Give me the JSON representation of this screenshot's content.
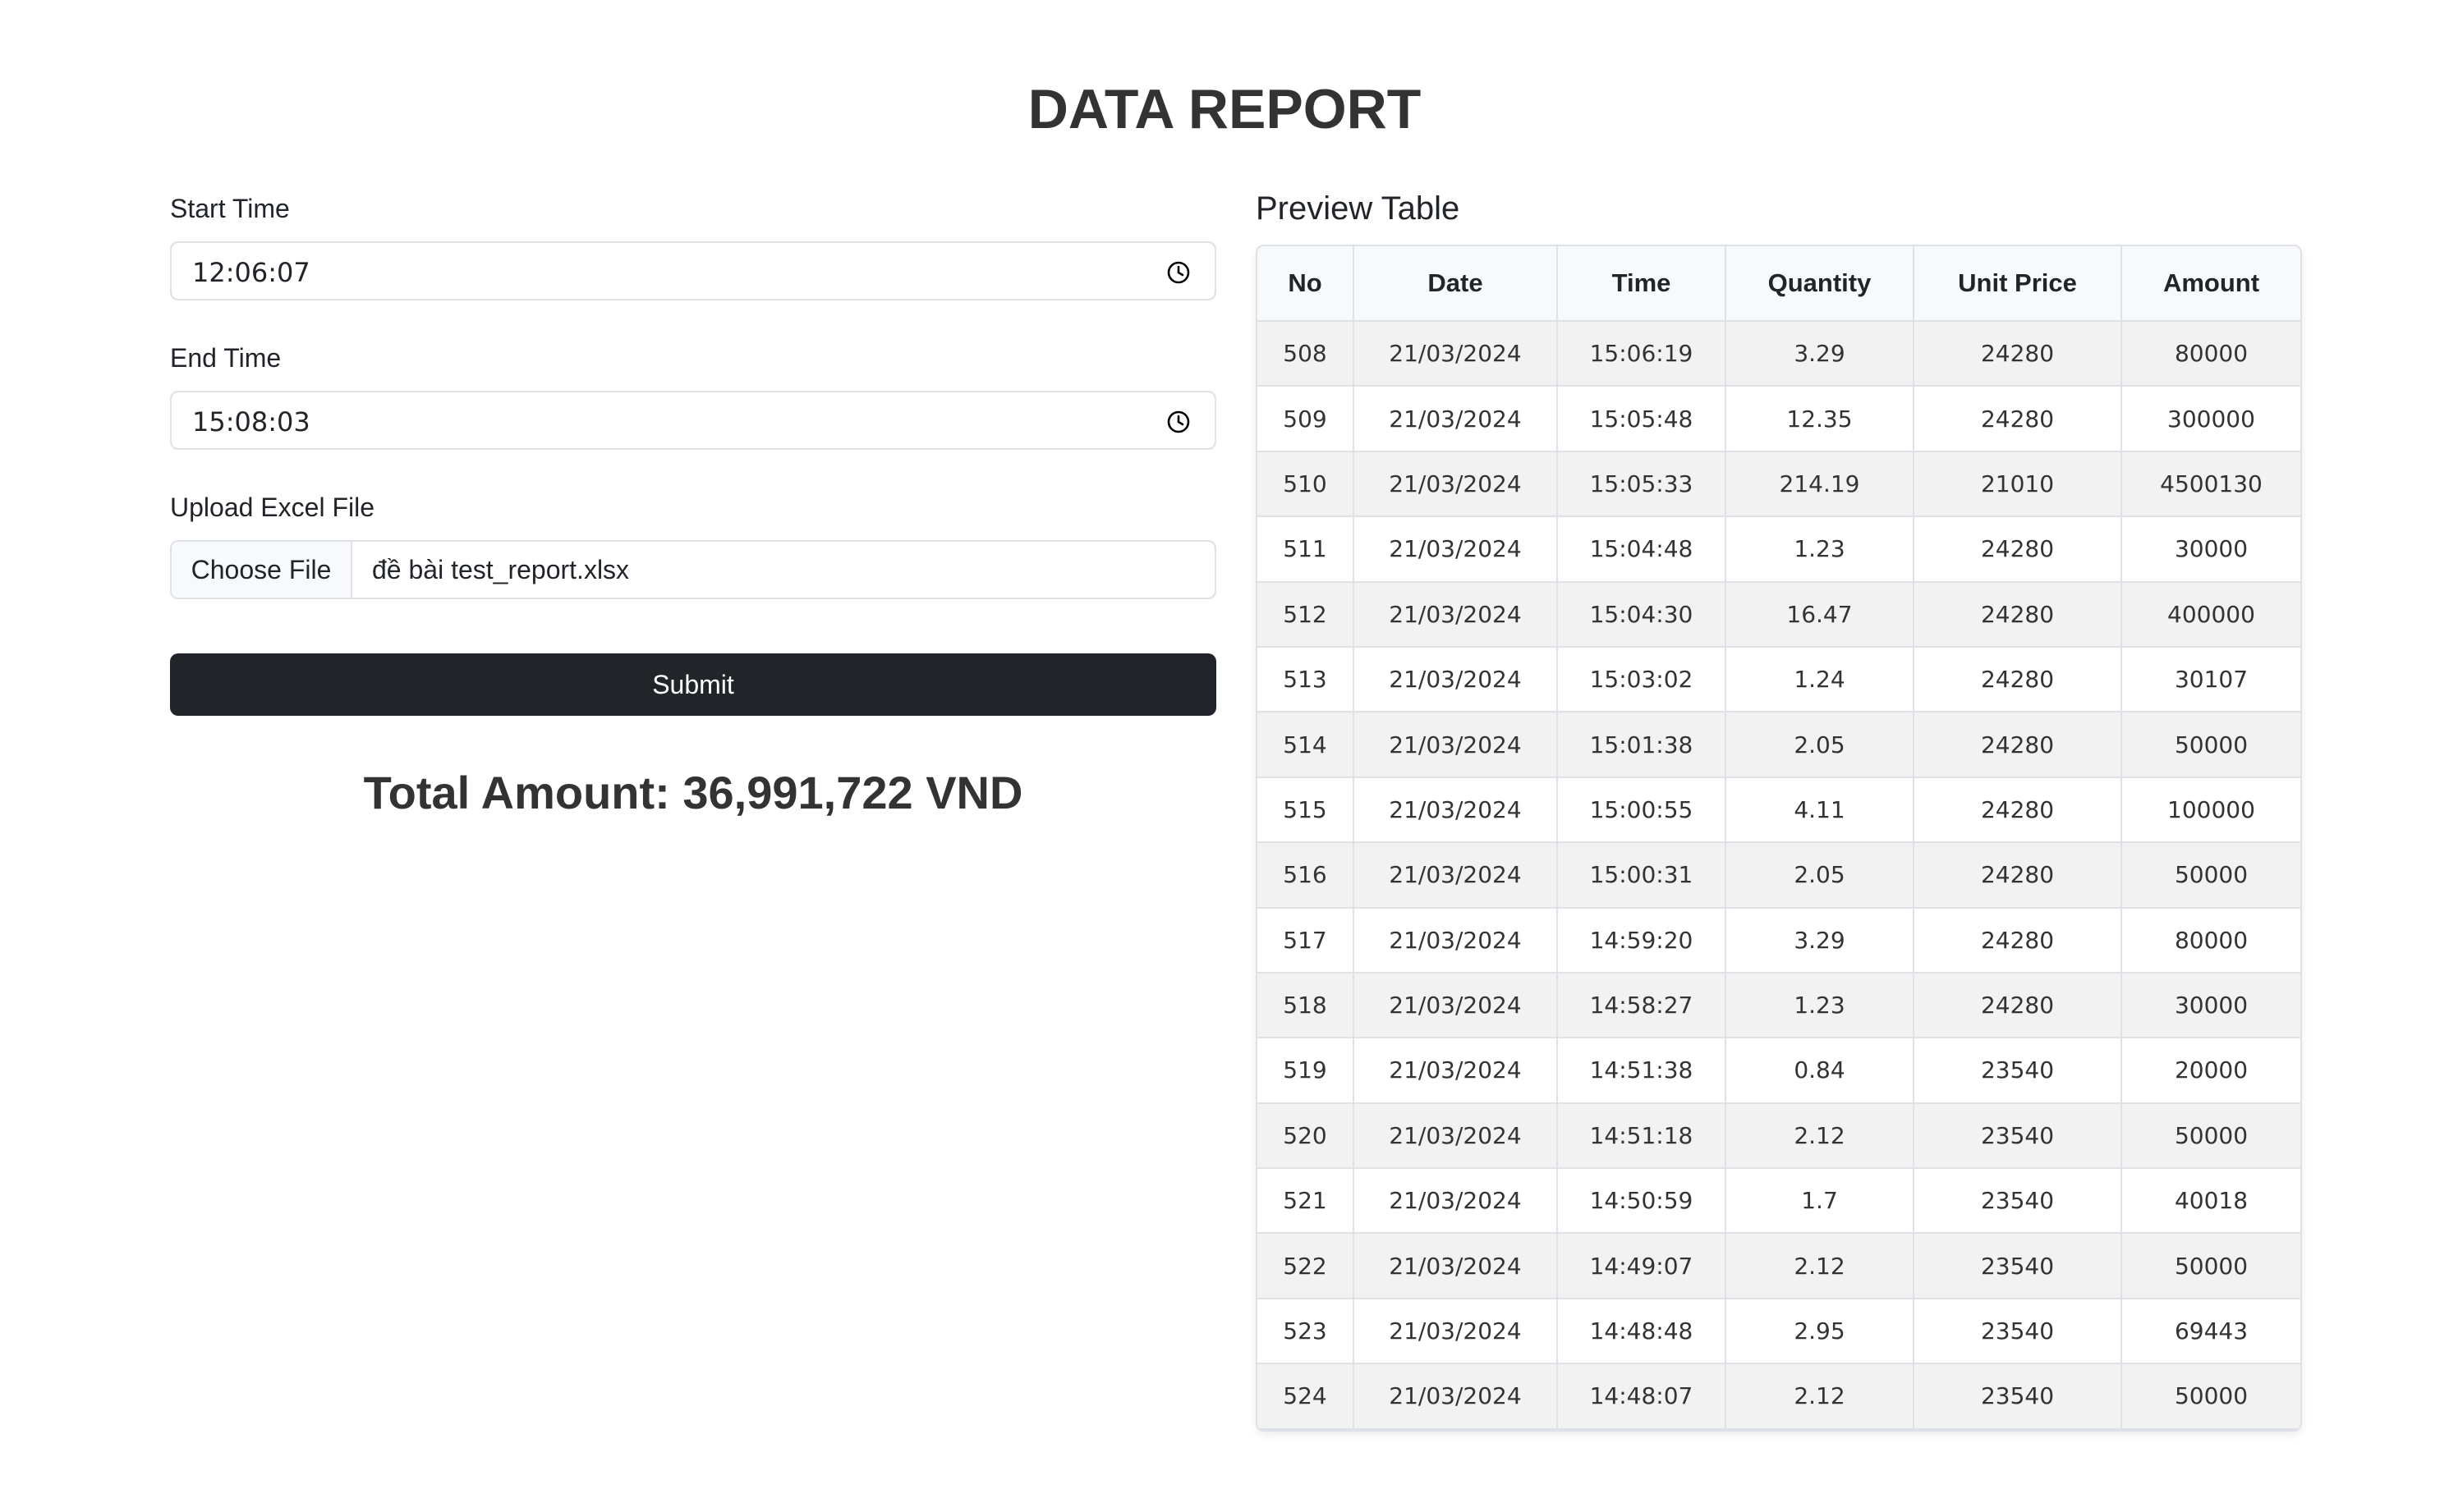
{
  "page": {
    "title": "DATA REPORT"
  },
  "form": {
    "start_time": {
      "label": "Start Time",
      "value": "12:06:07"
    },
    "end_time": {
      "label": "End Time",
      "value": "15:08:03"
    },
    "upload": {
      "label": "Upload Excel File",
      "button": "Choose File",
      "file_name": "đề bài test_report.xlsx"
    },
    "submit_label": "Submit",
    "total": "Total Amount: 36,991,722 VND"
  },
  "preview": {
    "title": "Preview Table",
    "columns": [
      "No",
      "Date",
      "Time",
      "Quantity",
      "Unit Price",
      "Amount"
    ],
    "rows": [
      [
        "508",
        "21/03/2024",
        "15:06:19",
        "3.29",
        "24280",
        "80000"
      ],
      [
        "509",
        "21/03/2024",
        "15:05:48",
        "12.35",
        "24280",
        "300000"
      ],
      [
        "510",
        "21/03/2024",
        "15:05:33",
        "214.19",
        "21010",
        "4500130"
      ],
      [
        "511",
        "21/03/2024",
        "15:04:48",
        "1.23",
        "24280",
        "30000"
      ],
      [
        "512",
        "21/03/2024",
        "15:04:30",
        "16.47",
        "24280",
        "400000"
      ],
      [
        "513",
        "21/03/2024",
        "15:03:02",
        "1.24",
        "24280",
        "30107"
      ],
      [
        "514",
        "21/03/2024",
        "15:01:38",
        "2.05",
        "24280",
        "50000"
      ],
      [
        "515",
        "21/03/2024",
        "15:00:55",
        "4.11",
        "24280",
        "100000"
      ],
      [
        "516",
        "21/03/2024",
        "15:00:31",
        "2.05",
        "24280",
        "50000"
      ],
      [
        "517",
        "21/03/2024",
        "14:59:20",
        "3.29",
        "24280",
        "80000"
      ],
      [
        "518",
        "21/03/2024",
        "14:58:27",
        "1.23",
        "24280",
        "30000"
      ],
      [
        "519",
        "21/03/2024",
        "14:51:38",
        "0.84",
        "23540",
        "20000"
      ],
      [
        "520",
        "21/03/2024",
        "14:51:18",
        "2.12",
        "23540",
        "50000"
      ],
      [
        "521",
        "21/03/2024",
        "14:50:59",
        "1.7",
        "23540",
        "40018"
      ],
      [
        "522",
        "21/03/2024",
        "14:49:07",
        "2.12",
        "23540",
        "50000"
      ],
      [
        "523",
        "21/03/2024",
        "14:48:48",
        "2.95",
        "23540",
        "69443"
      ],
      [
        "524",
        "21/03/2024",
        "14:48:07",
        "2.12",
        "23540",
        "50000"
      ]
    ]
  },
  "icons": {
    "time": "clock-icon"
  },
  "colors": {
    "submit_bg": "#212529",
    "header_bg": "#f8f9fa",
    "stripe": "#f2f2f2",
    "border": "#dee2e6"
  }
}
